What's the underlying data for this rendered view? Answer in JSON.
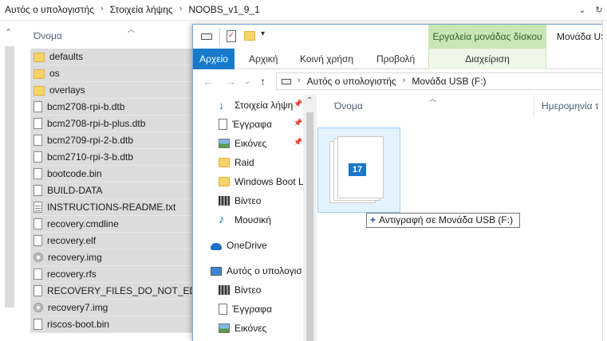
{
  "back_window": {
    "breadcrumb": [
      "Αυτός ο υπολογιστής",
      "Στοιχεία λήψης",
      "NOOBS_v1_9_1"
    ],
    "column_header": "Όνομα",
    "files": [
      {
        "name": "defaults",
        "type": "folder"
      },
      {
        "name": "os",
        "type": "folder"
      },
      {
        "name": "overlays",
        "type": "folder"
      },
      {
        "name": "bcm2708-rpi-b.dtb",
        "type": "file"
      },
      {
        "name": "bcm2708-rpi-b-plus.dtb",
        "type": "file"
      },
      {
        "name": "bcm2709-rpi-2-b.dtb",
        "type": "file"
      },
      {
        "name": "bcm2710-rpi-3-b.dtb",
        "type": "file"
      },
      {
        "name": "bootcode.bin",
        "type": "file"
      },
      {
        "name": "BUILD-DATA",
        "type": "file"
      },
      {
        "name": "INSTRUCTIONS-README.txt",
        "type": "text"
      },
      {
        "name": "recovery.cmdline",
        "type": "file"
      },
      {
        "name": "recovery.elf",
        "type": "file"
      },
      {
        "name": "recovery.img",
        "type": "disc"
      },
      {
        "name": "recovery.rfs",
        "type": "file"
      },
      {
        "name": "RECOVERY_FILES_DO_NOT_EDIT",
        "type": "file"
      },
      {
        "name": "recovery7.img",
        "type": "disc"
      },
      {
        "name": "riscos-boot.bin",
        "type": "file"
      }
    ]
  },
  "front_window": {
    "title": "Μονάδα USB",
    "context_tab": "Εργαλεία μονάδας δίσκου",
    "context_subtab": "Διαχείριση",
    "ribbon_tabs": [
      "Αρχείο",
      "Αρχική",
      "Κοινή χρήση",
      "Προβολή"
    ],
    "address": [
      "Αυτός ο υπολογιστής",
      "Μονάδα USB (F:)"
    ],
    "nav_items": [
      {
        "label": "Στοιχεία λήψη",
        "icon": "download-icon",
        "pinned": true
      },
      {
        "label": "Έγγραφα",
        "icon": "documents-icon",
        "pinned": true
      },
      {
        "label": "Εικόνες",
        "icon": "pictures-icon",
        "pinned": true
      },
      {
        "label": "Raid",
        "icon": "folder-icon",
        "pinned": false
      },
      {
        "label": "Windows Boot L",
        "icon": "folder-icon",
        "pinned": false
      },
      {
        "label": "Βίντεο",
        "icon": "video-icon",
        "pinned": false
      },
      {
        "label": "Μουσική",
        "icon": "music-icon",
        "pinned": false
      },
      {
        "label": "OneDrive",
        "icon": "onedrive-icon",
        "pinned": false
      },
      {
        "label": "Αυτός ο υπολογισ",
        "icon": "computer-icon",
        "pinned": false
      },
      {
        "label": "Βίντεο",
        "icon": "video-icon",
        "pinned": false
      },
      {
        "label": "Έγγραφα",
        "icon": "documents-icon",
        "pinned": false
      },
      {
        "label": "Εικόνες",
        "icon": "pictures-icon",
        "pinned": false
      }
    ],
    "col_name": "Όνομα",
    "col_date": "Ημερομηνία τ"
  },
  "drag": {
    "count": "17",
    "tooltip": "Αντιγραφή σε Μονάδα USB (F:)"
  },
  "colors": {
    "file_tab": "#1979ca",
    "context_tab": "#c9e7b5",
    "selection": "#dcdcdc",
    "badge": "#1976c8"
  }
}
